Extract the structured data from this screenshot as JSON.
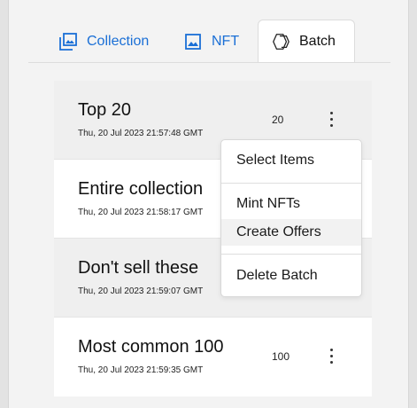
{
  "tabs": [
    {
      "label": "Collection",
      "icon": "image-stack-icon",
      "active": false
    },
    {
      "label": "NFT",
      "icon": "image-icon",
      "active": false
    },
    {
      "label": "Batch",
      "icon": "hexagons-icon",
      "active": true
    }
  ],
  "batches": [
    {
      "title": "Top 20",
      "date": "Thu, 20 Jul 2023 21:57:48 GMT",
      "count": "20"
    },
    {
      "title": "Entire collection",
      "date": "Thu, 20 Jul 2023 21:58:17 GMT",
      "count": ""
    },
    {
      "title": "Don't sell these",
      "date": "Thu, 20 Jul 2023 21:59:07 GMT",
      "count": ""
    },
    {
      "title": "Most common 100",
      "date": "Thu, 20 Jul 2023 21:59:35 GMT",
      "count": "100"
    }
  ],
  "menu": {
    "items": [
      "Select Items",
      "Mint NFTs",
      "Create Offers",
      "Delete Batch"
    ],
    "highlighted": "Create Offers"
  },
  "colors": {
    "accent": "#1a6fd6",
    "row_alt": "#efefef"
  }
}
